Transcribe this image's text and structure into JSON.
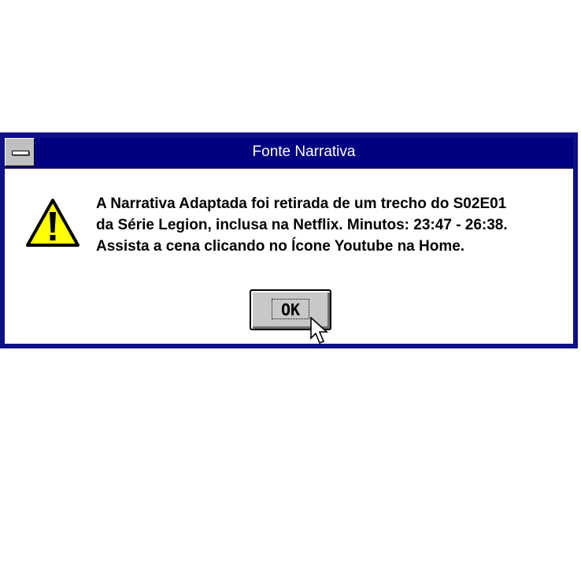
{
  "window": {
    "title": "Fonte Narrativa",
    "titlebar_color": "#000080",
    "border_color": "#101088",
    "system_menu_icon": "minus-bar-icon"
  },
  "dialog": {
    "icon": "warning-icon",
    "icon_color": "#ffff00",
    "message_lines": [
      "A Narrativa Adaptada foi retirada de um trecho do S02E01",
      "da Série Legion, inclusa na Netflix. Minutos: 23:47 - 26:38.",
      "Assista a cena clicando no Ícone Youtube na Home."
    ],
    "ok_label": "OK"
  },
  "pointer": {
    "icon": "mouse-cursor-icon"
  }
}
